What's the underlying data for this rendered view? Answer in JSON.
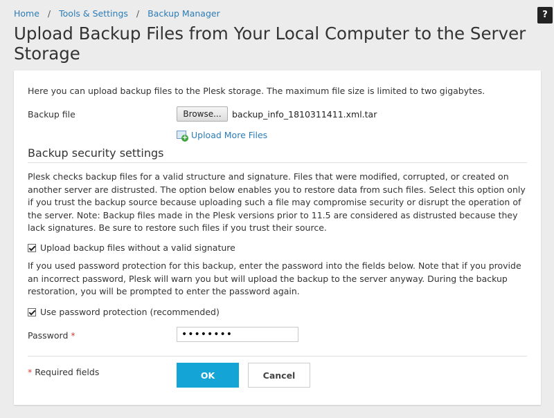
{
  "breadcrumb": {
    "items": [
      "Home",
      "Tools & Settings",
      "Backup Manager"
    ],
    "separator": "/"
  },
  "help": {
    "label": "?"
  },
  "page": {
    "title": "Upload Backup Files from Your Local Computer to the Server Storage"
  },
  "form": {
    "intro": "Here you can upload backup files to the Plesk storage. The maximum file size is limited to two gigabytes.",
    "backup_file_label": "Backup file",
    "browse_label": "Browse...",
    "file_name": "backup_info_1810311411.xml.tar",
    "upload_more_label": "Upload More Files",
    "security_title": "Backup security settings",
    "security_text": "Plesk checks backup files for a valid structure and signature. Files that were modified, corrupted, or created on another server are distrusted. The option below enables you to restore data from such files. Select this option only if you trust the backup source because uploading such a file may compromise security or disrupt the operation of the server. Note: Backup files made in the Plesk versions prior to 11.5 are considered as distrusted because they lack signatures. Be sure to restore such files if you trust their source.",
    "no_signature_label": "Upload backup files without a valid signature",
    "no_signature_checked": true,
    "password_text": "If you used password protection for this backup, enter the password into the fields below. Note that if you provide an incorrect password, Plesk will warn you but will upload the backup to the server anyway. During the backup restoration, you will be prompted to enter the password again.",
    "use_password_label": "Use password protection (recommended)",
    "use_password_checked": true,
    "password_label": "Password",
    "password_value": "••••••••",
    "required_marker": "*",
    "required_note": "Required fields",
    "ok_label": "OK",
    "cancel_label": "Cancel"
  },
  "colors": {
    "link": "#2b7cb6",
    "primary_button": "#14a4d6",
    "required": "#d43f3a",
    "background": "#ececec"
  },
  "icons": {
    "upload_more": "add-file-icon",
    "checkbox": "checkmark-icon"
  }
}
